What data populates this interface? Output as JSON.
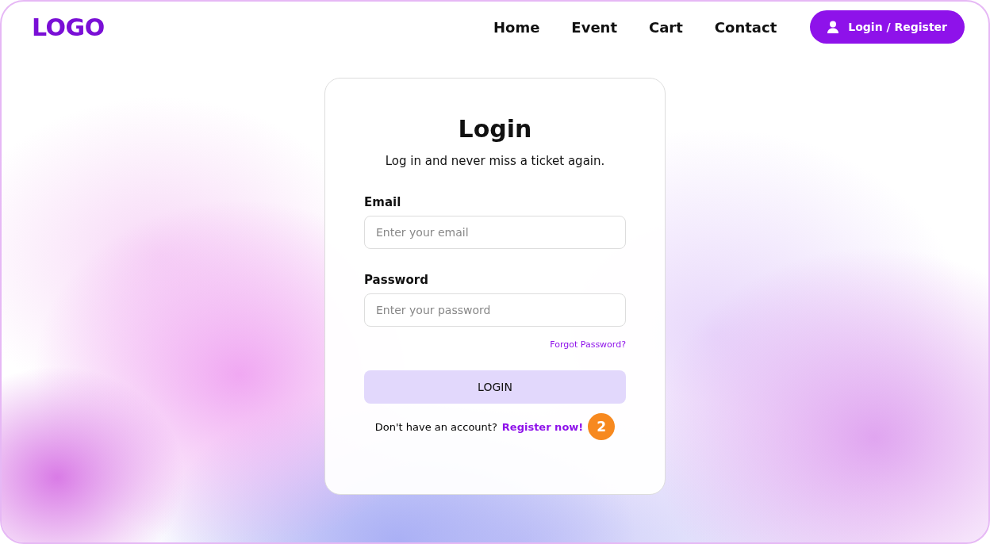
{
  "header": {
    "logo": "LOGO",
    "nav": [
      {
        "label": "Home"
      },
      {
        "label": "Event"
      },
      {
        "label": "Cart"
      },
      {
        "label": "Contact"
      }
    ],
    "account_button": "Login / Register"
  },
  "login_card": {
    "title": "Login",
    "subtitle": "Log in and never miss a ticket again.",
    "fields": [
      {
        "label": "Email",
        "placeholder": "Enter your email"
      },
      {
        "label": "Password",
        "placeholder": "Enter your password"
      }
    ],
    "forgot_link": "Forgot Password?",
    "submit": "LOGIN",
    "register_prompt": "Don't have an account?",
    "register_link": "Register now!",
    "marker": "2"
  }
}
